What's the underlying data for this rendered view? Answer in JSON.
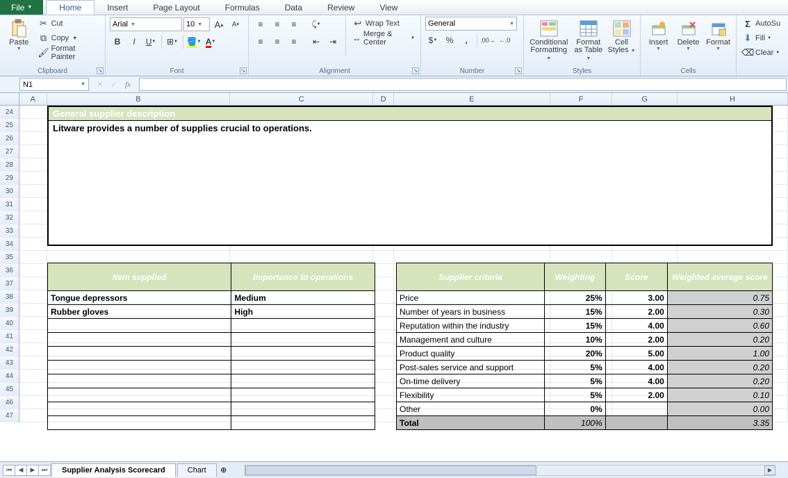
{
  "tabs": {
    "file": "File",
    "home": "Home",
    "insert": "Insert",
    "pagelayout": "Page Layout",
    "formulas": "Formulas",
    "data": "Data",
    "review": "Review",
    "view": "View"
  },
  "ribbon": {
    "clipboard": {
      "paste": "Paste",
      "cut": "Cut",
      "copy": "Copy",
      "fmtpaint": "Format Painter",
      "label": "Clipboard"
    },
    "font": {
      "name": "Arial",
      "size": "10",
      "label": "Font"
    },
    "align": {
      "wrap": "Wrap Text",
      "merge": "Merge & Center",
      "label": "Alignment"
    },
    "number": {
      "fmt": "General",
      "label": "Number"
    },
    "styles": {
      "cond": "Conditional Formatting",
      "condL2": "Formatting",
      "ftbl": "Format as Table",
      "ftblL1": "Format",
      "ftblL2": "as Table",
      "cell": "Cell Styles",
      "cellL1": "Cell",
      "cellL2": "Styles",
      "label": "Styles"
    },
    "cells": {
      "insert": "Insert",
      "delete": "Delete",
      "format": "Format",
      "label": "Cells"
    },
    "editing": {
      "sum": "AutoSu",
      "fill": "Fill",
      "clear": "Clear"
    }
  },
  "namebox": "N1",
  "columns": [
    "A",
    "B",
    "C",
    "D",
    "E",
    "F",
    "G",
    "H"
  ],
  "rowstart": 24,
  "rowend": 47,
  "content": {
    "descHdr": "General supplier description",
    "descBody": "Litware provides a number of supplies crucial to operations.",
    "left": {
      "h1": "Item supplied",
      "h2": "Importance to operations",
      "rows": [
        {
          "item": "Tongue depressors",
          "imp": "Medium"
        },
        {
          "item": "Rubber gloves",
          "imp": "High"
        },
        {
          "item": "",
          "imp": ""
        },
        {
          "item": "",
          "imp": ""
        },
        {
          "item": "",
          "imp": ""
        },
        {
          "item": "",
          "imp": ""
        },
        {
          "item": "",
          "imp": ""
        },
        {
          "item": "",
          "imp": ""
        },
        {
          "item": "",
          "imp": ""
        },
        {
          "item": "",
          "imp": ""
        }
      ]
    },
    "right": {
      "h1": "Supplier criteria",
      "h2": "Weighting",
      "h3": "Score",
      "h4": "Weighted average score",
      "rows": [
        {
          "c": "Price",
          "w": "25%",
          "s": "3.00",
          "ws": "0.75"
        },
        {
          "c": "Number of years in business",
          "w": "15%",
          "s": "2.00",
          "ws": "0.30"
        },
        {
          "c": "Reputation within the industry",
          "w": "15%",
          "s": "4.00",
          "ws": "0.60"
        },
        {
          "c": "Management and culture",
          "w": "10%",
          "s": "2.00",
          "ws": "0.20"
        },
        {
          "c": "Product quality",
          "w": "20%",
          "s": "5.00",
          "ws": "1.00"
        },
        {
          "c": "Post-sales service and support",
          "w": "5%",
          "s": "4.00",
          "ws": "0.20"
        },
        {
          "c": "On-time delivery",
          "w": "5%",
          "s": "4.00",
          "ws": "0.20"
        },
        {
          "c": "Flexibility",
          "w": "5%",
          "s": "2.00",
          "ws": "0.10"
        },
        {
          "c": "Other",
          "w": "0%",
          "s": "",
          "ws": "0.00"
        }
      ],
      "total": {
        "label": "Total",
        "w": "100%",
        "s": "",
        "ws": "3.35"
      }
    }
  },
  "sheets": {
    "s1": "Supplier Analysis Scorecard",
    "s2": "Chart"
  }
}
